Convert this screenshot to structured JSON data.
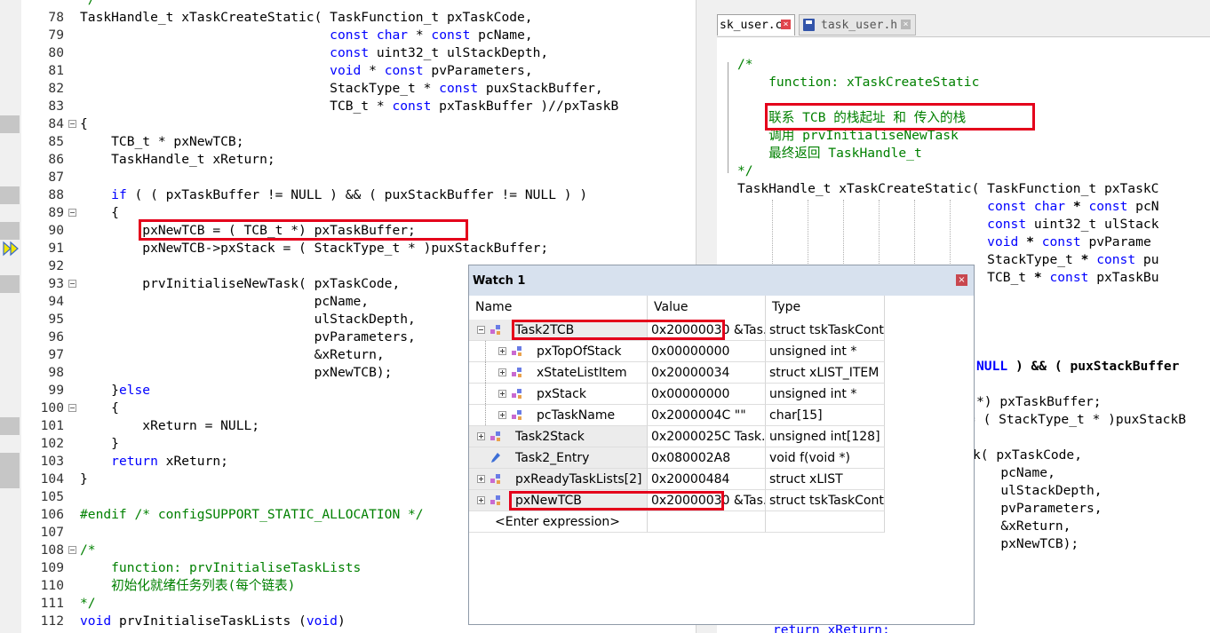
{
  "left_editor": {
    "partial_top": "*/",
    "lines": [
      {
        "num": "78",
        "fold": false,
        "text": "TaskHandle_t xTaskCreateStatic( TaskFunction_t pxTaskCode,"
      },
      {
        "num": "79",
        "fold": false,
        "text": "                                const char * const pcName,"
      },
      {
        "num": "80",
        "fold": false,
        "text": "                                const uint32_t ulStackDepth,"
      },
      {
        "num": "81",
        "fold": false,
        "text": "                                void * const pvParameters,"
      },
      {
        "num": "82",
        "fold": false,
        "text": "                                StackType_t * const puxStackBuffer,"
      },
      {
        "num": "83",
        "fold": false,
        "text": "                                TCB_t * const pxTaskBuffer )//pxTaskB"
      },
      {
        "num": "84",
        "fold": true,
        "text": "{"
      },
      {
        "num": "85",
        "fold": false,
        "text": "    TCB_t * pxNewTCB;"
      },
      {
        "num": "86",
        "fold": false,
        "text": "    TaskHandle_t xReturn;"
      },
      {
        "num": "87",
        "fold": false,
        "text": ""
      },
      {
        "num": "88",
        "fold": false,
        "text": "    if ( ( pxTaskBuffer != NULL ) && ( puxStackBuffer != NULL ) )"
      },
      {
        "num": "89",
        "fold": true,
        "text": "    {"
      },
      {
        "num": "90",
        "fold": false,
        "text": "        pxNewTCB = ( TCB_t *) pxTaskBuffer;"
      },
      {
        "num": "91",
        "fold": false,
        "text": "        pxNewTCB->pxStack = ( StackType_t * )puxStackBuffer;"
      },
      {
        "num": "92",
        "fold": false,
        "text": ""
      },
      {
        "num": "93",
        "fold": true,
        "text": "        prvInitialiseNewTask( pxTaskCode,"
      },
      {
        "num": "94",
        "fold": false,
        "text": "                              pcName,"
      },
      {
        "num": "95",
        "fold": false,
        "text": "                              ulStackDepth,"
      },
      {
        "num": "96",
        "fold": false,
        "text": "                              pvParameters,"
      },
      {
        "num": "97",
        "fold": false,
        "text": "                              &xReturn,"
      },
      {
        "num": "98",
        "fold": false,
        "text": "                              pxNewTCB);"
      },
      {
        "num": "99",
        "fold": false,
        "text": "    }else"
      },
      {
        "num": "100",
        "fold": true,
        "text": "    {"
      },
      {
        "num": "101",
        "fold": false,
        "text": "        xReturn = NULL;"
      },
      {
        "num": "102",
        "fold": false,
        "text": "    }"
      },
      {
        "num": "103",
        "fold": false,
        "text": "    return xReturn;"
      },
      {
        "num": "104",
        "fold": false,
        "text": "}"
      },
      {
        "num": "105",
        "fold": false,
        "text": ""
      },
      {
        "num": "106",
        "fold": false,
        "text": "#endif /* configSUPPORT_STATIC_ALLOCATION */"
      },
      {
        "num": "107",
        "fold": false,
        "text": ""
      },
      {
        "num": "108",
        "fold": true,
        "text": "/*"
      },
      {
        "num": "109",
        "fold": false,
        "text": "    function: prvInitialiseTaskLists"
      },
      {
        "num": "110",
        "fold": false,
        "text": "    初始化就绪任务列表(每个链表)"
      },
      {
        "num": "111",
        "fold": false,
        "text": "*/"
      },
      {
        "num": "112",
        "fold": false,
        "text": "void prvInitialiseTaskLists (void)"
      }
    ]
  },
  "right_editor": {
    "tabs": [
      {
        "label": "sk_user.c",
        "active": true
      },
      {
        "label": "task_user.h",
        "active": false
      }
    ],
    "lines": [
      {
        "text": ""
      },
      {
        "text": "/*"
      },
      {
        "text": "    function: xTaskCreateStatic"
      },
      {
        "text": ""
      },
      {
        "text": "    联系 TCB 的栈起址 和 传入的栈"
      },
      {
        "text": "    调用 prvInitialiseNewTask"
      },
      {
        "text": "    最终返回 TaskHandle_t"
      },
      {
        "text": "*/"
      },
      {
        "text": "TaskHandle_t xTaskCreateStatic( TaskFunction_t pxTaskC"
      },
      {
        "text": "                                const char * const pcN"
      },
      {
        "text": "                                const uint32_t ulStack"
      },
      {
        "text": "                                void * const pvParame"
      },
      {
        "text": "                                StackType_t * const pu"
      },
      {
        "text": "                                TCB_t * const pxTaskBu"
      }
    ],
    "visible_fragments": [
      {
        "text": "NULL ) && ( puxStackBuffer"
      },
      {
        "text": "*) pxTaskBuffer;"
      },
      {
        "text": "= ( StackType_t * )puxStackB"
      },
      {
        "text": "k( pxTaskCode,"
      },
      {
        "text": "   pcName,"
      },
      {
        "text": "   ulStackDepth,"
      },
      {
        "text": "   pvParameters,"
      },
      {
        "text": "   &xReturn,"
      },
      {
        "text": "   pxNewTCB);"
      },
      {
        "text": "return xReturn;"
      }
    ]
  },
  "watch": {
    "title": "Watch 1",
    "close_label": "×",
    "headers": {
      "name": "Name",
      "value": "Value",
      "type": "Type"
    },
    "rows": [
      {
        "name": "Task2TCB",
        "value": "0x20000030",
        "value_extra": " &Tas...",
        "type": "struct tskTaskCont...",
        "level": 0,
        "expander": "minus",
        "icon": "struct"
      },
      {
        "name": "pxTopOfStack",
        "value": "0x00000000",
        "value_extra": "",
        "type": "unsigned int *",
        "level": 1,
        "expander": "plus",
        "icon": "struct"
      },
      {
        "name": "xStateListItem",
        "value": "0x20000034",
        "value_extra": "",
        "type": "struct xLIST_ITEM",
        "level": 1,
        "expander": "plus",
        "icon": "struct"
      },
      {
        "name": "pxStack",
        "value": "0x00000000",
        "value_extra": "",
        "type": "unsigned int *",
        "level": 1,
        "expander": "plus",
        "icon": "struct"
      },
      {
        "name": "pcTaskName",
        "value": "0x2000004C \"\"",
        "value_extra": "",
        "type": "char[15]",
        "level": 1,
        "expander": "plus",
        "icon": "struct"
      },
      {
        "name": "Task2Stack",
        "value": "0x2000025C Task...",
        "value_extra": "",
        "type": "unsigned int[128]",
        "level": 0,
        "expander": "plus",
        "icon": "struct"
      },
      {
        "name": "Task2_Entry",
        "value": "0x080002A8",
        "value_extra": "",
        "type": "void f(void *)",
        "level": 0,
        "expander": "none",
        "icon": "func"
      },
      {
        "name": "pxReadyTaskLists[2]",
        "value": "0x20000484",
        "value_extra": "",
        "type": "struct xLIST",
        "level": 0,
        "expander": "plus",
        "icon": "struct"
      },
      {
        "name": "pxNewTCB",
        "value": "0x20000030",
        "value_extra": " &Tas...",
        "type": "struct tskTaskCont...",
        "level": 0,
        "expander": "plus",
        "icon": "struct"
      }
    ],
    "enter_expression": "<Enter expression>"
  },
  "colors": {
    "keyword": "#0000ff",
    "comment": "#008000",
    "highlight_box": "#e4001b",
    "watch_title_bg": "#d7e1ee"
  }
}
